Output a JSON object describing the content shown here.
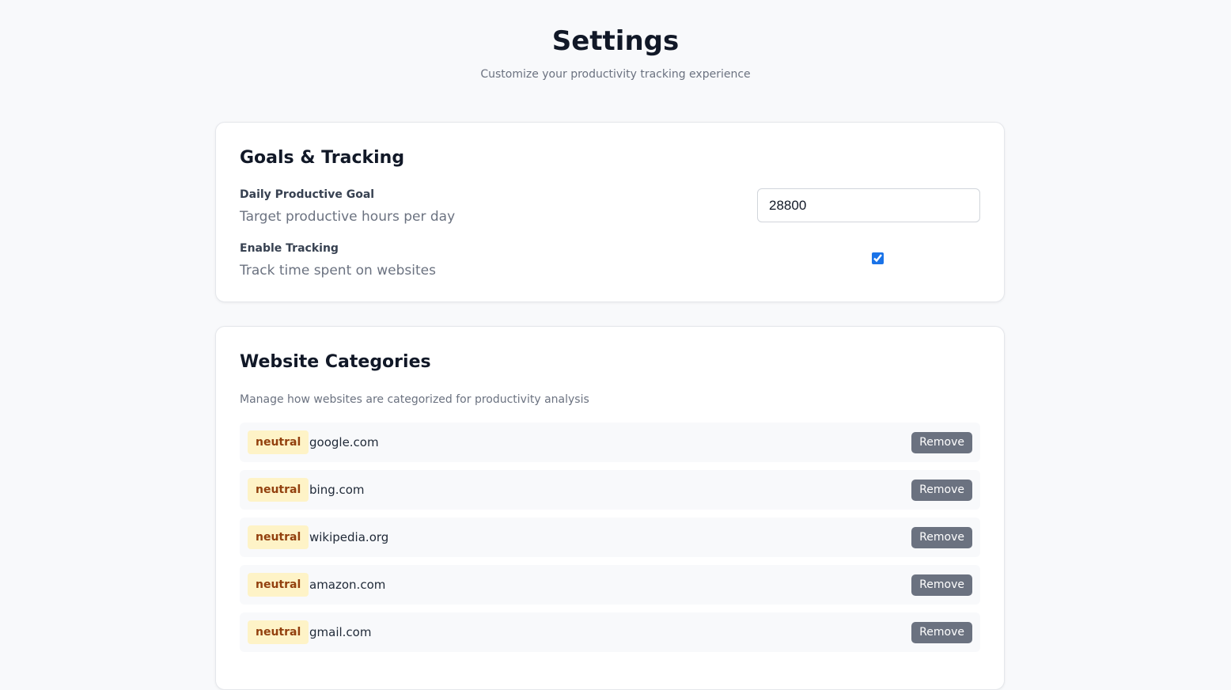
{
  "header": {
    "title": "Settings",
    "subtitle": "Customize your productivity tracking experience"
  },
  "goals": {
    "title": "Goals & Tracking",
    "daily_goal": {
      "label": "Daily Productive Goal",
      "description": "Target productive hours per day",
      "value": "28800"
    },
    "tracking": {
      "label": "Enable Tracking",
      "description": "Track time spent on websites",
      "checked": true
    }
  },
  "categories": {
    "title": "Website Categories",
    "description": "Manage how websites are categorized for productivity analysis",
    "remove_label": "Remove",
    "items": [
      {
        "category": "neutral",
        "domain": "google.com"
      },
      {
        "category": "neutral",
        "domain": "bing.com"
      },
      {
        "category": "neutral",
        "domain": "wikipedia.org"
      },
      {
        "category": "neutral",
        "domain": "amazon.com"
      },
      {
        "category": "neutral",
        "domain": "gmail.com"
      }
    ]
  },
  "colors": {
    "badge_neutral_bg": "#fef3c7",
    "badge_neutral_text": "#92400e",
    "remove_button_bg": "#6b7280",
    "checkbox_accent": "#1a73e8"
  }
}
